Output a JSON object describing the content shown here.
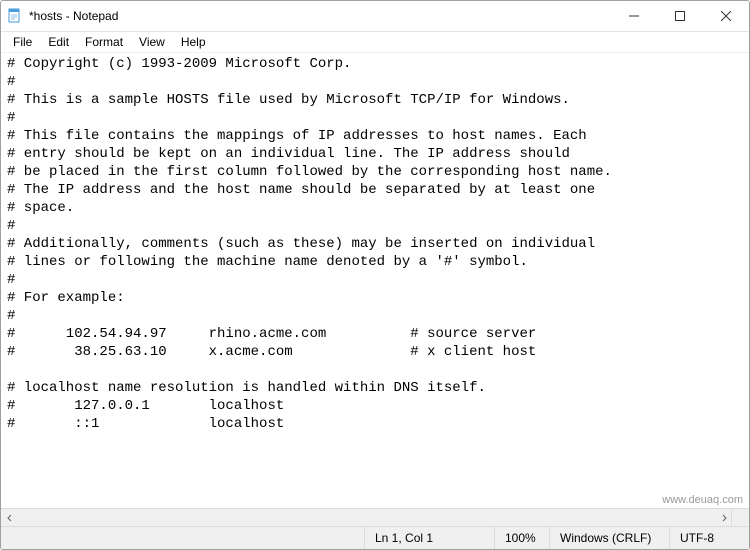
{
  "window": {
    "title": "*hosts - Notepad"
  },
  "menu": {
    "file": "File",
    "edit": "Edit",
    "format": "Format",
    "view": "View",
    "help": "Help"
  },
  "content_lines": [
    "# Copyright (c) 1993-2009 Microsoft Corp.",
    "#",
    "# This is a sample HOSTS file used by Microsoft TCP/IP for Windows.",
    "#",
    "# This file contains the mappings of IP addresses to host names. Each",
    "# entry should be kept on an individual line. The IP address should",
    "# be placed in the first column followed by the corresponding host name.",
    "# The IP address and the host name should be separated by at least one",
    "# space.",
    "#",
    "# Additionally, comments (such as these) may be inserted on individual",
    "# lines or following the machine name denoted by a '#' symbol.",
    "#",
    "# For example:",
    "#",
    "#      102.54.94.97     rhino.acme.com          # source server",
    "#       38.25.63.10     x.acme.com              # x client host",
    "",
    "# localhost name resolution is handled within DNS itself.",
    "#       127.0.0.1       localhost",
    "#       ::1             localhost"
  ],
  "status": {
    "cursor": "Ln 1, Col 1",
    "zoom": "100%",
    "line_ending": "Windows (CRLF)",
    "encoding": "UTF-8"
  },
  "watermark": "www.deuaq.com"
}
